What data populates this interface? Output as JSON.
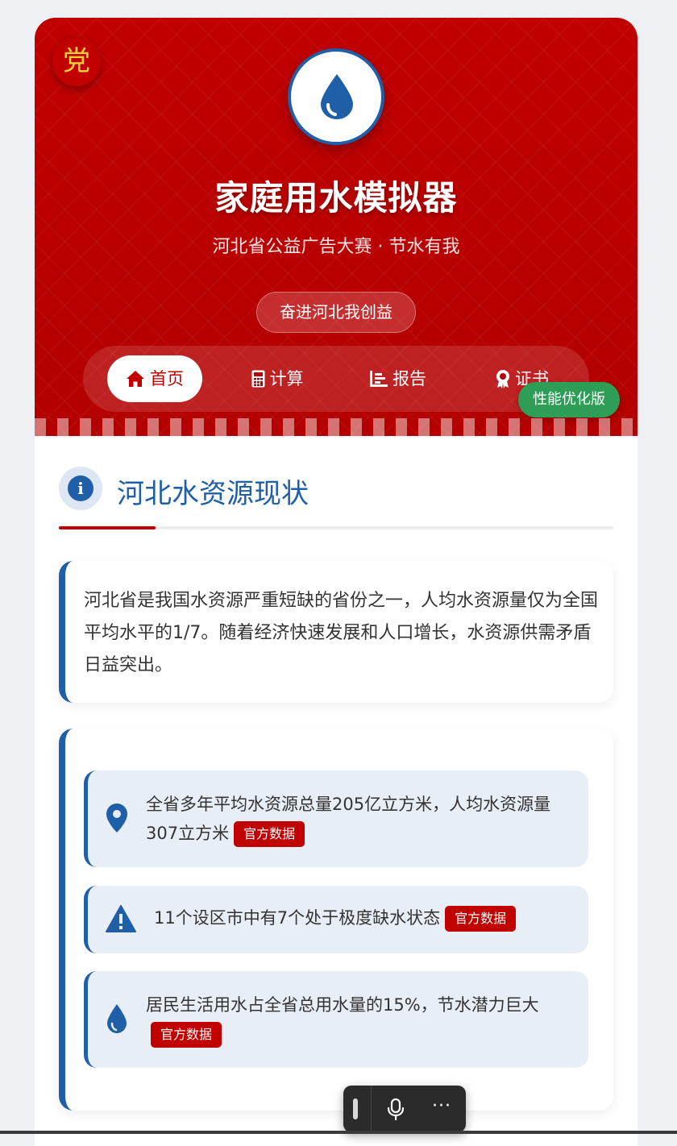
{
  "header": {
    "party_badge": "党",
    "logo_icon": "water-drop-icon",
    "title": "家庭用水模拟器",
    "subtitle": "河北省公益广告大赛 · 节水有我",
    "slogan": "奋进河北我创益",
    "perf_badge": "性能优化版",
    "nav": [
      {
        "label": "首页",
        "icon": "home-icon",
        "active": true
      },
      {
        "label": "计算",
        "icon": "calculator-icon",
        "active": false
      },
      {
        "label": "报告",
        "icon": "chart-icon",
        "active": false
      },
      {
        "label": "证书",
        "icon": "award-icon",
        "active": false
      }
    ]
  },
  "section": {
    "icon": "info-icon",
    "title": "河北水资源现状"
  },
  "intro": {
    "text": "河北省是我国水资源严重短缺的省份之一，人均水资源量仅为全国平均水平的1/7。随着经济快速发展和人口增长，水资源供需矛盾日益突出。"
  },
  "facts": [
    {
      "icon": "map-pin-icon",
      "text": "全省多年平均水资源总量205亿立方米，人均水资源量307立方米",
      "tag": "官方数据"
    },
    {
      "icon": "warning-icon",
      "text": "11个设区市中有7个处于极度缺水状态",
      "tag": "官方数据"
    },
    {
      "icon": "water-drop-icon",
      "text": "居民生活用水占全省总用水量的15%，节水潜力巨大",
      "tag": "官方数据"
    }
  ],
  "colors": {
    "brand_red": "#c10000",
    "brand_blue": "#1f5fa8",
    "success_green": "#2e9e57"
  }
}
